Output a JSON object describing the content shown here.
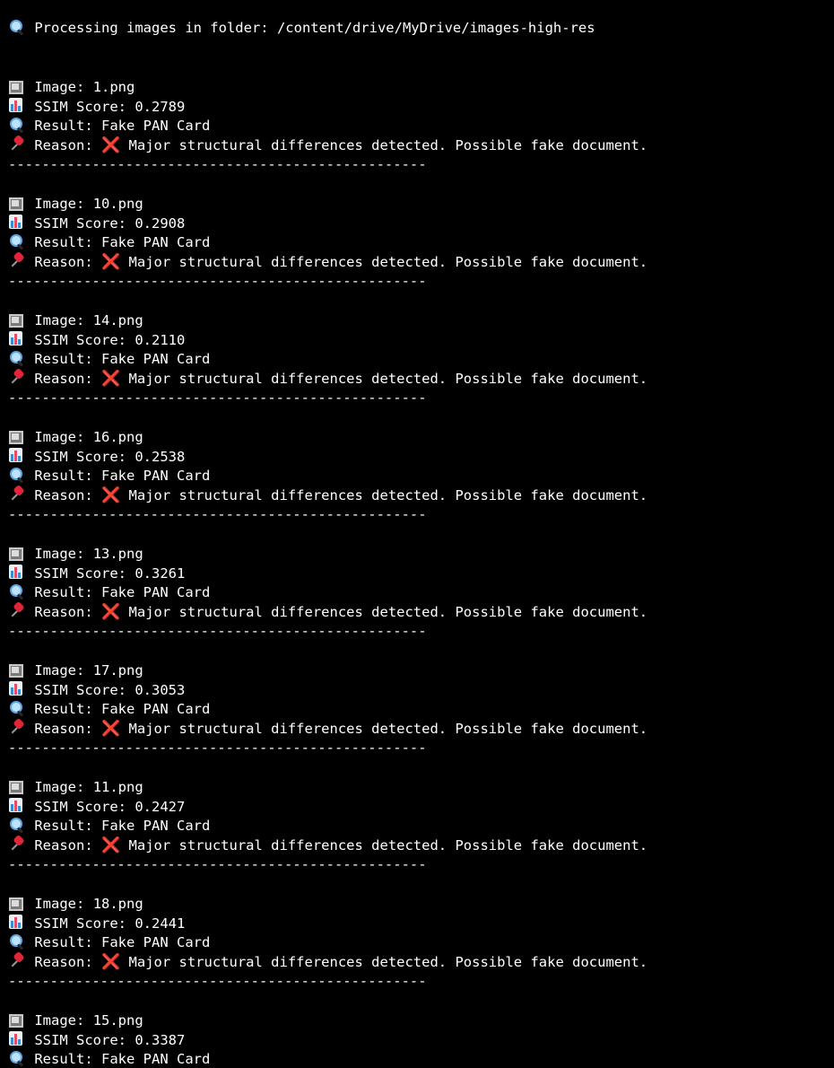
{
  "header": {
    "icon": "magnifier-icon",
    "text": "Processing images in folder: /content/drive/MyDrive/images-high-res"
  },
  "labels": {
    "image": "Image:",
    "score": "SSIM Score:",
    "result": "Result:",
    "reason": "Reason:",
    "separator": "--------------------------------------------------"
  },
  "entries": [
    {
      "image": "1.png",
      "score": "0.2789",
      "result": "Fake PAN Card",
      "reason": "Major structural differences detected. Possible fake document."
    },
    {
      "image": "10.png",
      "score": "0.2908",
      "result": "Fake PAN Card",
      "reason": "Major structural differences detected. Possible fake document."
    },
    {
      "image": "14.png",
      "score": "0.2110",
      "result": "Fake PAN Card",
      "reason": "Major structural differences detected. Possible fake document."
    },
    {
      "image": "16.png",
      "score": "0.2538",
      "result": "Fake PAN Card",
      "reason": "Major structural differences detected. Possible fake document."
    },
    {
      "image": "13.png",
      "score": "0.3261",
      "result": "Fake PAN Card",
      "reason": "Major structural differences detected. Possible fake document."
    },
    {
      "image": "17.png",
      "score": "0.3053",
      "result": "Fake PAN Card",
      "reason": "Major structural differences detected. Possible fake document."
    },
    {
      "image": "11.png",
      "score": "0.2427",
      "result": "Fake PAN Card",
      "reason": "Major structural differences detected. Possible fake document."
    },
    {
      "image": "18.png",
      "score": "0.2441",
      "result": "Fake PAN Card",
      "reason": "Major structural differences detected. Possible fake document."
    },
    {
      "image": "15.png",
      "score": "0.3387",
      "result": "Fake PAN Card",
      "reason": ""
    }
  ],
  "icons": {
    "image": "frame-icon",
    "score": "bar-chart-icon",
    "result": "magnifier-icon",
    "reason": "pushpin-icon",
    "reason_mark": "❌"
  },
  "colors": {
    "background": "#000000",
    "text": "#ffffff",
    "cross": "#f0304a"
  }
}
